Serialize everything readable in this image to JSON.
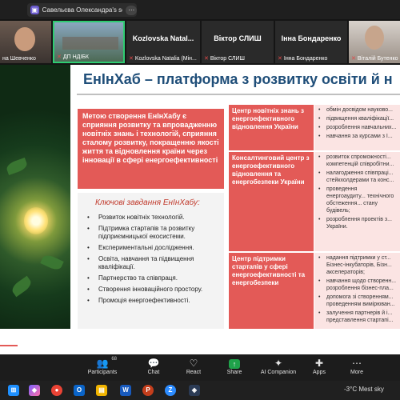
{
  "screen_share": {
    "label": "Савельєва Олександра's screen"
  },
  "participants_strip": [
    {
      "name": "на Шевченко"
    },
    {
      "name": "ДП НДІБК"
    },
    {
      "display": "Kozlovska Natal...",
      "name": "Kozlovska Natalia (Мін..."
    },
    {
      "display": "Віктор СЛИШ",
      "name": "Віктор СЛИШ"
    },
    {
      "display": "Інна Бондаренко",
      "name": "Інна Бондаренко"
    },
    {
      "name": "Віталій Бутенко"
    }
  ],
  "slide": {
    "title": "ЕнІнХаб – платформа з розвитку освіти й н",
    "goal": "Метою створення ЕнІнХабу є сприяння розвитку та впровадженню новітніх знань і технологій, сприяння сталому розвитку, покращенню якості життя та відновлення країни через інновації в сфері енергоефективності",
    "tasks_title": "Ключові завдання ЕнІнХабу:",
    "tasks": [
      "Розвиток новітніх технологій.",
      "Підтримка стартапів та розвитку підприємницької екосистеми.",
      "Експериментальні дослідження.",
      "Освіта, навчання та підвищення кваліфікації.",
      "Партнерство та співпраця.",
      "Створення інноваційного простору.",
      "Промоція енергоефективності."
    ],
    "centers": [
      {
        "name": "Центр новітніх знань з енергоефективного відновлення України",
        "items": [
          "обмін досвідом науково...",
          "підвищення кваліфікації...",
          "розроблення навчальних...",
          "навчання за курсами з І..."
        ]
      },
      {
        "name": "Консалтинговий центр з енергоефективного відновлення та енергобезпеки України",
        "items": [
          "розвиток спроможності... компетенцій співробітни...",
          "налагодження співпраці... стейкхолдерами та конс...",
          "проведення енергоаудиту... технічного обстеження... стану будівель;",
          "розроблення проектів з... України."
        ]
      },
      {
        "name": "Центр підтримки стартапів у сфері енергоефективності та енергобезпеки",
        "items": [
          "надання підтримки у ст... Бізнес-інкубаторів, Бізн... акселераторів;",
          "навчання щодо створенн... розроблення бізнес-пла...",
          "допомога зі створенням... проведенням вимірюван...",
          "залучення партнерів й і... представлення стартапі..."
        ]
      }
    ]
  },
  "toolbar": {
    "participants_label": "Participants",
    "participants_count": "68",
    "chat_label": "Chat",
    "react_label": "React",
    "share_label": "Share",
    "ai_label": "AI Companion",
    "apps_label": "Apps",
    "more_label": "More"
  },
  "taskbar": {
    "weather": "-3°C  Mest sky"
  }
}
